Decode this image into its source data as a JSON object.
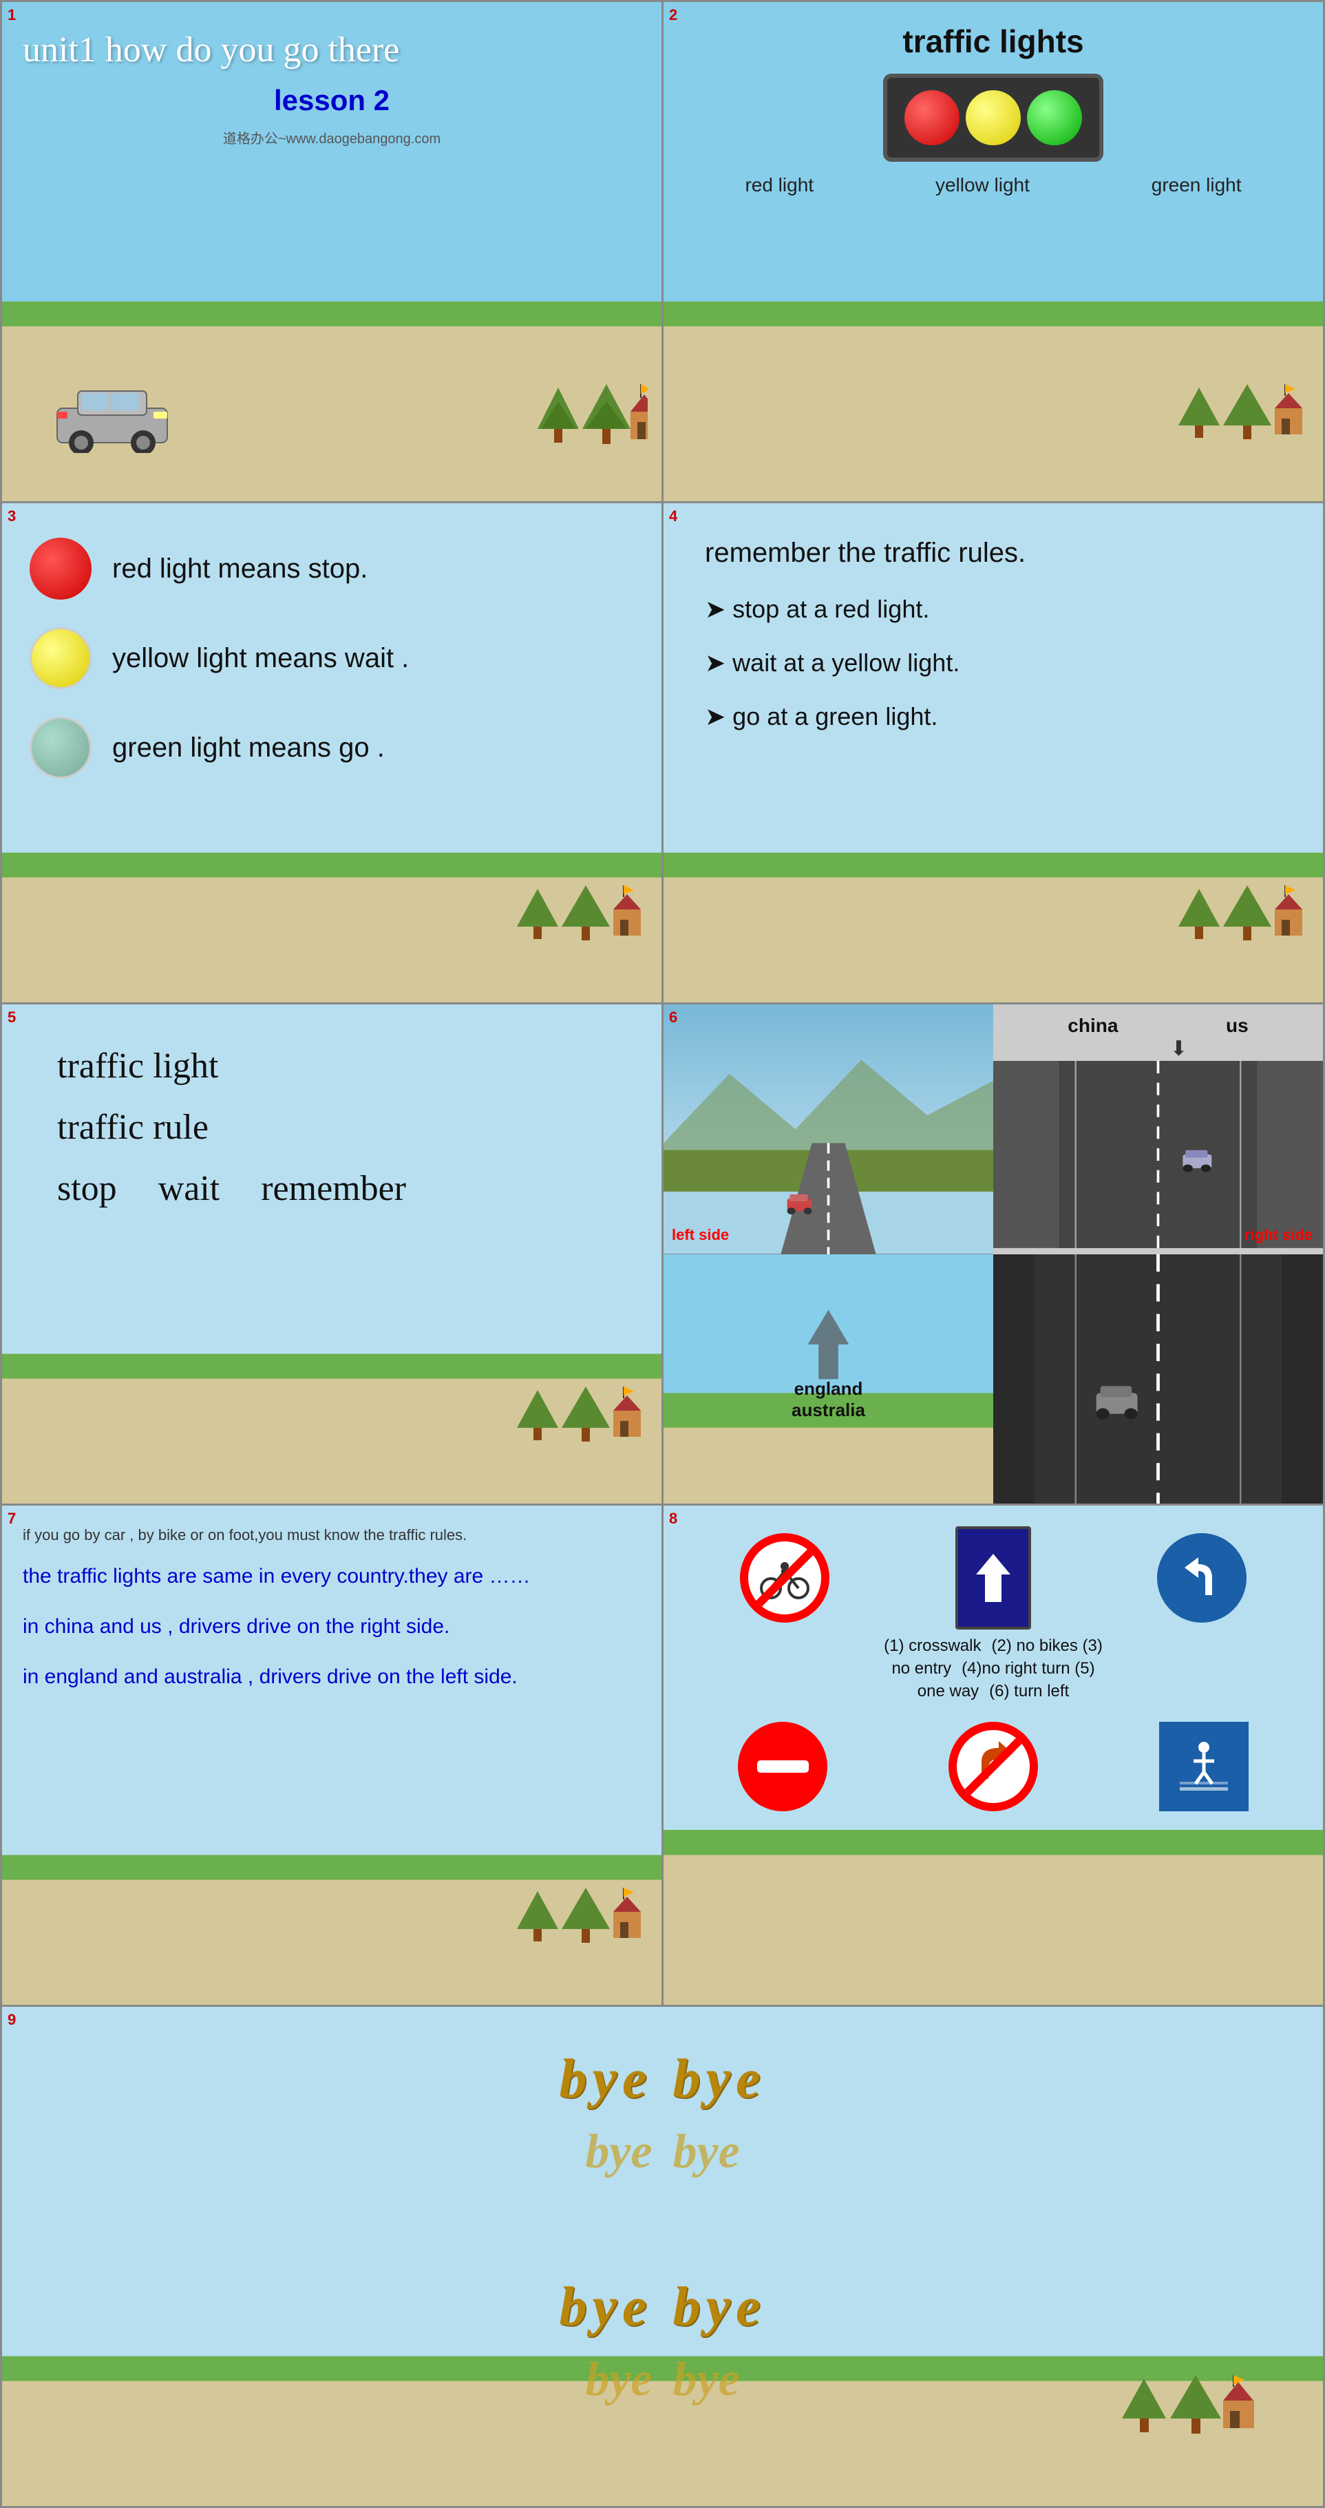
{
  "slides": [
    {
      "id": 1,
      "number": "1",
      "title": "unit1 how do you go there",
      "subtitle": "lesson 2",
      "watermark": "道格办公~www.daogebangong.com"
    },
    {
      "id": 2,
      "number": "2",
      "title": "traffic  lights",
      "labels": [
        "red light",
        "yellow light",
        "green light"
      ]
    },
    {
      "id": 3,
      "number": "3",
      "meanings": [
        {
          "color": "red",
          "text": "red light means stop."
        },
        {
          "color": "yellow",
          "text": "yellow light means wait ."
        },
        {
          "color": "green",
          "text": "green light means go ."
        }
      ]
    },
    {
      "id": 4,
      "number": "4",
      "title": "remember the traffic rules.",
      "rules": [
        "stop at a red light.",
        "wait at a yellow light.",
        "go at a green light."
      ]
    },
    {
      "id": 5,
      "number": "5",
      "vocab": [
        "traffic light",
        "traffic rule",
        "stop",
        "wait",
        "remember"
      ]
    },
    {
      "id": 6,
      "number": "6",
      "country1": "china",
      "country2": "us",
      "label1": "left side",
      "label2": "right side",
      "label3": "england",
      "label4": "australia"
    },
    {
      "id": 7,
      "number": "7",
      "small_text": "if you go by car , by bike or on foot,you must know the traffic rules.",
      "blue_texts": [
        "the traffic lights are same in every country.they are ……",
        "in china and us , drivers drive on the right side.",
        "in england and australia , drivers drive on the left side."
      ]
    },
    {
      "id": 8,
      "number": "8",
      "signs_top_labels": [
        "(1)  crosswalk",
        "(2)  no bikes  (3)",
        "no entry",
        "(4)no right turn   (5)",
        "one way",
        "(6)  turn left"
      ],
      "signs_bottom_labels": [
        "no entry sign",
        "no right turn sign",
        "crosswalk sign"
      ]
    },
    {
      "id": 9,
      "number": "9",
      "bye_texts": [
        "bye  bye",
        "bye  bye",
        "bye  bye",
        "bye  bye"
      ]
    }
  ]
}
